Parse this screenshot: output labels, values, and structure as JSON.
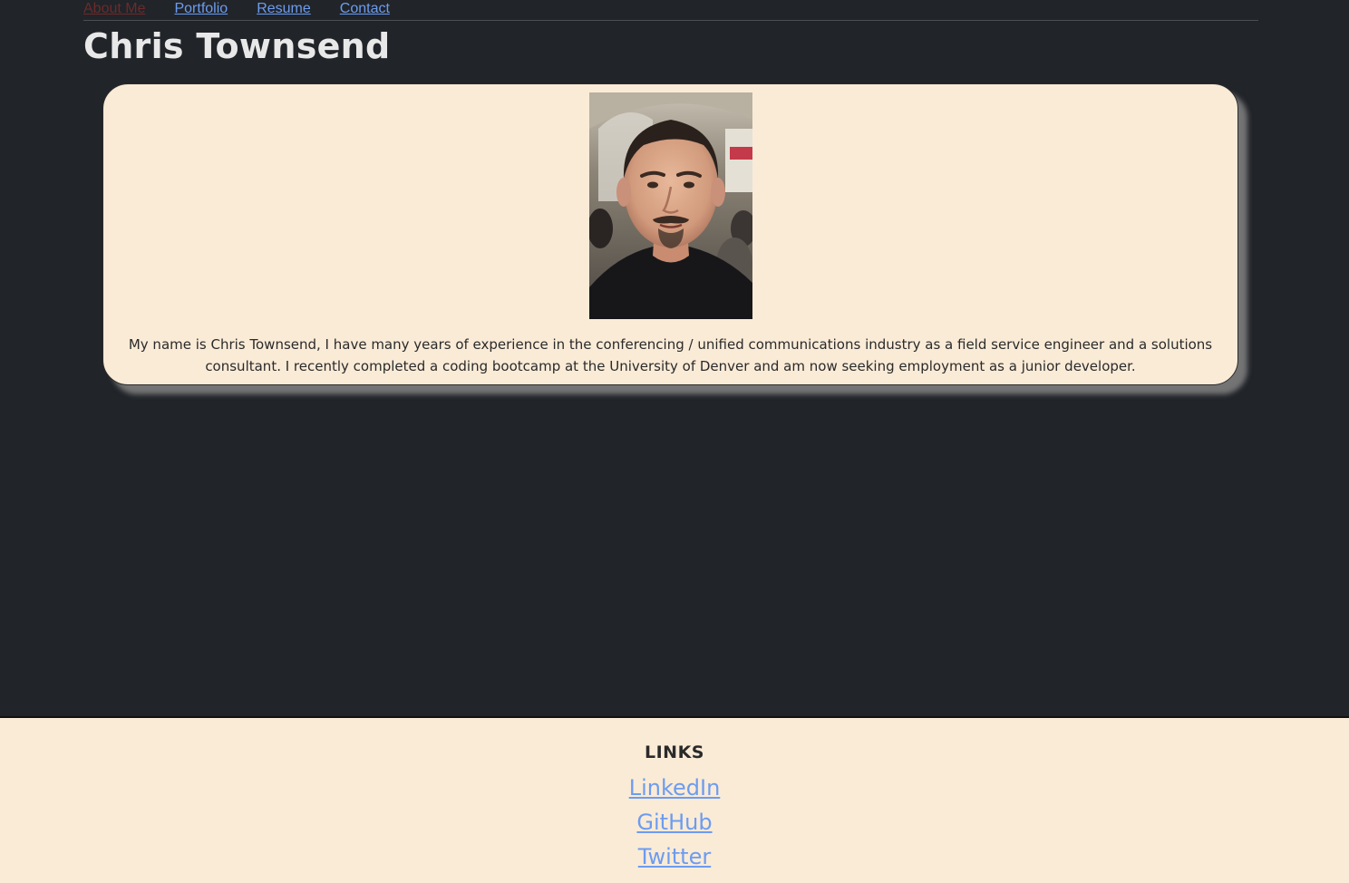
{
  "nav": {
    "items": [
      {
        "label": "About Me",
        "active": true
      },
      {
        "label": "Portfolio",
        "active": false
      },
      {
        "label": "Resume",
        "active": false
      },
      {
        "label": "Contact",
        "active": false
      }
    ]
  },
  "header": {
    "title": "Chris Townsend"
  },
  "about": {
    "photo_alt": "profile photo",
    "bio": "My name is Chris Townsend, I have many years of experience in the conferencing / unified communications industry as a field service engineer and a solutions consultant. I recently completed a coding bootcamp at the University of Denver and am now seeking employment as a junior developer."
  },
  "footer": {
    "heading": "LINKS",
    "links": [
      {
        "label": "LinkedIn"
      },
      {
        "label": "GitHub"
      },
      {
        "label": "Twitter"
      }
    ]
  },
  "colors": {
    "background": "#212429",
    "card": "#faebd7",
    "link": "#6c9cf0",
    "active_link": "#6b2b2b",
    "title": "#e8e8e8"
  }
}
